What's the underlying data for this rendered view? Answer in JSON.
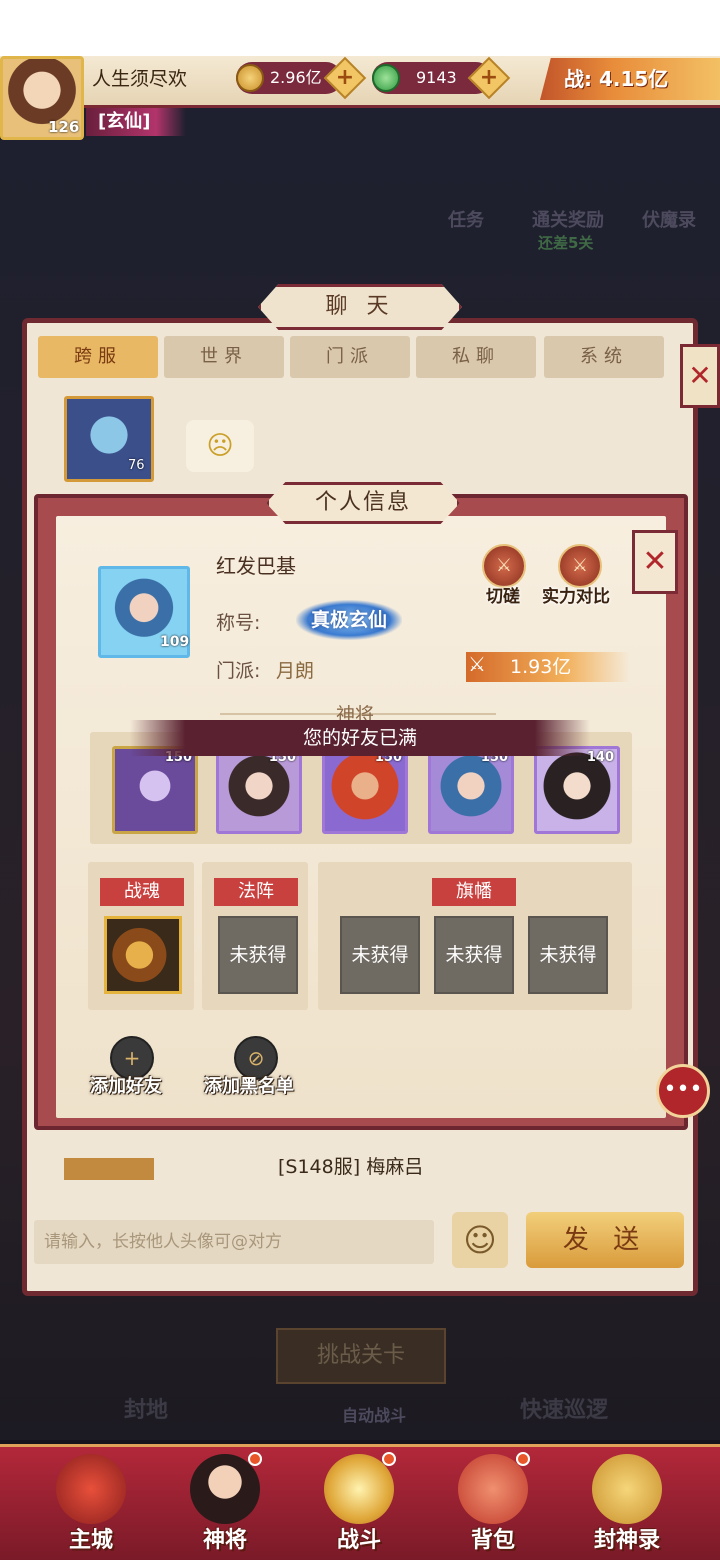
{
  "hud": {
    "player_name": "人生须尽欢",
    "level": "126",
    "rank": "[玄仙]",
    "gold": "2.96亿",
    "jade": "9143",
    "plus": "+",
    "power": "战: 4.15亿"
  },
  "background": {
    "task1": "任务",
    "task2": "通关奖励",
    "task3": "伏魔录",
    "sub": "还差5关",
    "challenge": "挑战关卡",
    "auto": "自动战斗",
    "left_feat": "封地",
    "right_feat": "快速巡逻"
  },
  "chat": {
    "title": "聊 天",
    "tabs": [
      "跨服",
      "世界",
      "门派",
      "私聊",
      "系统"
    ],
    "active_tab": "跨服",
    "msg1_level": "76",
    "msg2_text": "[S148服] 梅麻吕",
    "input_placeholder": "请输入，长按他人头像可@对方",
    "send": "发 送",
    "close": "✕"
  },
  "profile": {
    "title": "个人信息",
    "close": "✕",
    "hero_level": "109",
    "name": "红发巴基",
    "title_label": "称号:",
    "title_badge": "真极玄仙",
    "sect_label": "门派:",
    "sect_value": "月朗",
    "btn_spar": "切磋",
    "btn_compare": "实力对比",
    "power": "1.93亿",
    "section_generals": "神将",
    "toast": "您的好友已满",
    "heroes": [
      {
        "level": "150",
        "color": "#caa545"
      },
      {
        "level": "150",
        "color": "#9f7ad8"
      },
      {
        "level": "150",
        "color": "#9f7ad8"
      },
      {
        "level": "150",
        "color": "#9f7ad8"
      },
      {
        "level": "140",
        "color": "#9f7ad8"
      }
    ],
    "slot_zhanhun": "战魂",
    "slot_fazhen": "法阵",
    "slot_qifan": "旗幡",
    "not_obtained": "未获得",
    "add_friend": "添加好友",
    "add_blacklist": "添加黑名单"
  },
  "nav": {
    "items": [
      "主城",
      "神将",
      "战斗",
      "背包",
      "封神录"
    ]
  }
}
